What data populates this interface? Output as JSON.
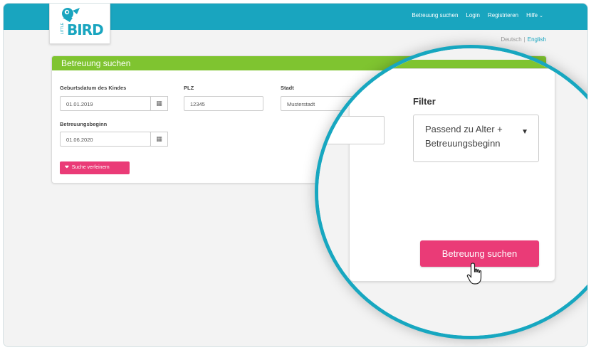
{
  "header": {
    "logo_word": "BIRD",
    "logo_small": "LITTLE",
    "nav": {
      "search": "Betreuung suchen",
      "login": "Login",
      "register": "Registrieren",
      "help": "Hilfe"
    },
    "accent_color": "#19a5bf"
  },
  "language": {
    "german": "Deutsch",
    "separator": "|",
    "english": "English",
    "active": "English"
  },
  "search_panel": {
    "title": "Betreuung suchen",
    "header_color": "#7fc430",
    "fields": {
      "birthdate_label": "Geburtsdatum des Kindes",
      "birthdate_value": "01.01.2019",
      "zip_label": "PLZ",
      "zip_value": "12345",
      "city_label": "Stadt",
      "city_value": "Musterstadt",
      "start_label": "Betreuungsbeginn",
      "start_value": "01.06.2020"
    },
    "refine_button": "Suche verfeinern",
    "button_color": "#ea3b77"
  },
  "magnified": {
    "filter_label": "Filter",
    "filter_value_line1": "Passend zu Alter +",
    "filter_value_line2": "Betreuungsbeginn",
    "search_button": "Betreuung suchen",
    "ring_color": "#17a7c0"
  },
  "icons": [
    "calendar-icon",
    "chevron-down-icon",
    "heart-icon",
    "hand-pointer-icon",
    "bird-logo-icon"
  ]
}
